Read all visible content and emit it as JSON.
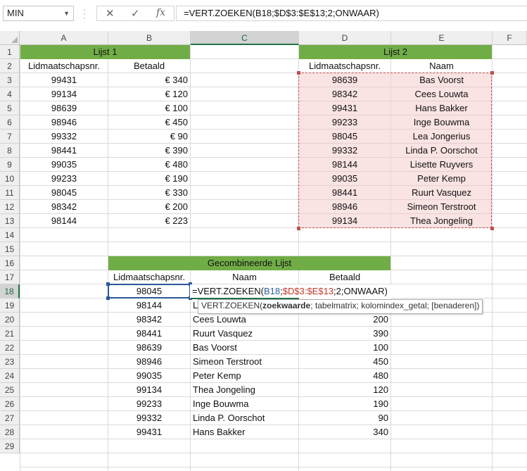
{
  "namebox": {
    "value": "MIN"
  },
  "formula_bar": {
    "cancel": "✕",
    "confirm": "✓",
    "fx": "fx",
    "formula": "=VERT.ZOEKEN(B18;$D$3:$E$13;2;ONWAAR)"
  },
  "columns": [
    "A",
    "B",
    "C",
    "D",
    "E",
    "F"
  ],
  "rows": [
    "1",
    "2",
    "3",
    "4",
    "5",
    "6",
    "7",
    "8",
    "9",
    "10",
    "11",
    "12",
    "13",
    "14",
    "15",
    "16",
    "17",
    "18",
    "19",
    "20",
    "21",
    "22",
    "23",
    "24",
    "25",
    "26",
    "27",
    "28",
    "29"
  ],
  "lijst1": {
    "title": "Lijst 1",
    "header_id": "Lidmaatschapsnr.",
    "header_paid": "Betaald",
    "ids": [
      "99431",
      "99134",
      "98639",
      "98946",
      "99332",
      "98441",
      "99035",
      "99233",
      "98045",
      "98342",
      "98144"
    ],
    "paid": [
      "€ 340",
      "€ 120",
      "€ 100",
      "€ 450",
      "€ 90",
      "€ 390",
      "€ 480",
      "€ 190",
      "€ 330",
      "€ 200",
      "€ 223"
    ]
  },
  "lijst2": {
    "title": "Lijst 2",
    "header_id": "Lidmaatschapsnr.",
    "header_name": "Naam",
    "ids": [
      "98639",
      "98342",
      "99431",
      "99233",
      "98045",
      "99332",
      "98144",
      "99035",
      "98441",
      "98946",
      "99134"
    ],
    "names": [
      "Bas Voorst",
      "Cees Louwta",
      "Hans Bakker",
      "Inge Bouwma",
      "Lea Jongerius",
      "Linda P. Oorschot",
      "Lisette Ruyvers",
      "Peter Kemp",
      "Ruurt Vasquez",
      "Simeon Terstroot",
      "Thea Jongeling"
    ]
  },
  "combined": {
    "title": "Gecombineerde Lijst",
    "header_id": "Lidmaatschapsnr.",
    "header_name": "Naam",
    "header_paid": "Betaald",
    "ids": [
      "98045",
      "98144",
      "98342",
      "98441",
      "98639",
      "98946",
      "99035",
      "99134",
      "99233",
      "99332",
      "99431"
    ],
    "names": [
      "",
      "L",
      "Cees Louwta",
      "Ruurt Vasquez",
      "Bas Voorst",
      "Simeon Terstroot",
      "Peter Kemp",
      "Thea Jongeling",
      "Inge Bouwma",
      "Linda P. Oorschot",
      "Hans Bakker"
    ],
    "paid": [
      "",
      "",
      "200",
      "390",
      "100",
      "450",
      "480",
      "120",
      "190",
      "90",
      "340"
    ]
  },
  "edit": {
    "prefix": "=VERT.ZOEKEN(",
    "ref1": "B18",
    "sep1": ";",
    "ref2": "$D$3:$E$13",
    "suffix": ";2;ONWAAR)"
  },
  "tooltip": {
    "func": "VERT.ZOEKEN(",
    "arg_bold": "zoekwaarde",
    "rest": "; tabelmatrix; kolomindex_getal; [benaderen])"
  }
}
